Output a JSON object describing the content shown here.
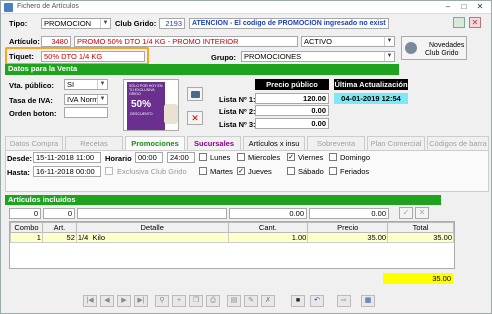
{
  "window": {
    "title": "Fichero de Artículos"
  },
  "header": {
    "tipo_label": "Tipo:",
    "tipo_value": "PROMOCION",
    "club_grido_label": "Club Grido:",
    "club_grido_value": "2193",
    "warning": "ATENCION - El codigo de PROMOCION ingresado no exist",
    "articulo_label": "Artículo:",
    "articulo_code": "3480",
    "articulo_name": "PROMO 50% DTO 1/4 KG - PROMO INTERIOR",
    "estado_value": "ACTIVO",
    "tiquet_label": "Tiquet:",
    "tiquet_value": "50% DTO 1/4 KG",
    "grupo_label": "Grupo:",
    "grupo_value": "PROMOCIONES",
    "novedades_label_1": "Novedades",
    "novedades_label_2": "Club Grido"
  },
  "venta": {
    "section_title": "Datos para la Venta",
    "vta_publico_label": "Vta. público:",
    "vta_publico_value": "SI",
    "tasa_iva_label": "Tasa de IVA:",
    "tasa_iva_value": "IVA Normal",
    "orden_boton_label": "Orden boton:",
    "orden_boton_value": "",
    "promo_image_top": "SÓLO POR HOY EN TU EXCLUSIVA GRIDO",
    "promo_image_pct": "50%",
    "promo_image_bottom": "DESCUENTO",
    "precio_publico_header": "Precio público",
    "lista1_label": "Lista Nº 1:",
    "lista1_value": "120.00",
    "lista2_label": "Lista Nº 2:",
    "lista2_value": "0.00",
    "lista3_label": "Lista Nº 3:",
    "lista3_value": "0.00",
    "ultima_act_header": "Última Actualización",
    "ultima_act_value": "04-01-2019 12:54"
  },
  "tabs": [
    {
      "label": "Datos Compra"
    },
    {
      "label": "Recetas"
    },
    {
      "label": "Promociones"
    },
    {
      "label": "Sucursales"
    },
    {
      "label": "Artículos x insu"
    },
    {
      "label": "Sobreventa"
    },
    {
      "label": "Plan Comercial"
    },
    {
      "label": "Códigos de barra"
    }
  ],
  "promo": {
    "desde_label": "Desde:",
    "desde_value": "15-11-2018 11:00",
    "hasta_label": "Hasta:",
    "hasta_value": "16-11-2018 00:00",
    "horario_label": "Horario",
    "horario_from": "00:00",
    "horario_to": "24:00",
    "exclusiva_label": "Exclusiva Club Grido",
    "days": [
      {
        "label": "Lunes",
        "checked": false
      },
      {
        "label": "Miercoles",
        "checked": false
      },
      {
        "label": "Viernes",
        "checked": true
      },
      {
        "label": "Domingo",
        "checked": false
      },
      {
        "label": "Martes",
        "checked": false
      },
      {
        "label": "Jueves",
        "checked": true
      },
      {
        "label": "Sábado",
        "checked": false
      },
      {
        "label": "Feriados",
        "checked": false
      }
    ]
  },
  "included": {
    "section_title": "Artículos incluidos",
    "input_combo": "0",
    "input_art": "0",
    "input_detalle": "",
    "input_cant": "0.00",
    "input_precio": "0.00",
    "columns": [
      "Combo",
      "Art.",
      "Detalle",
      "Cant.",
      "Precio",
      "Total"
    ],
    "rows": [
      {
        "combo": "1",
        "art": "52",
        "detalle": "1/4  Kilo",
        "cant": "1.00",
        "precio": "35.00",
        "total": "35.00"
      }
    ],
    "grand_total": "35.00"
  }
}
